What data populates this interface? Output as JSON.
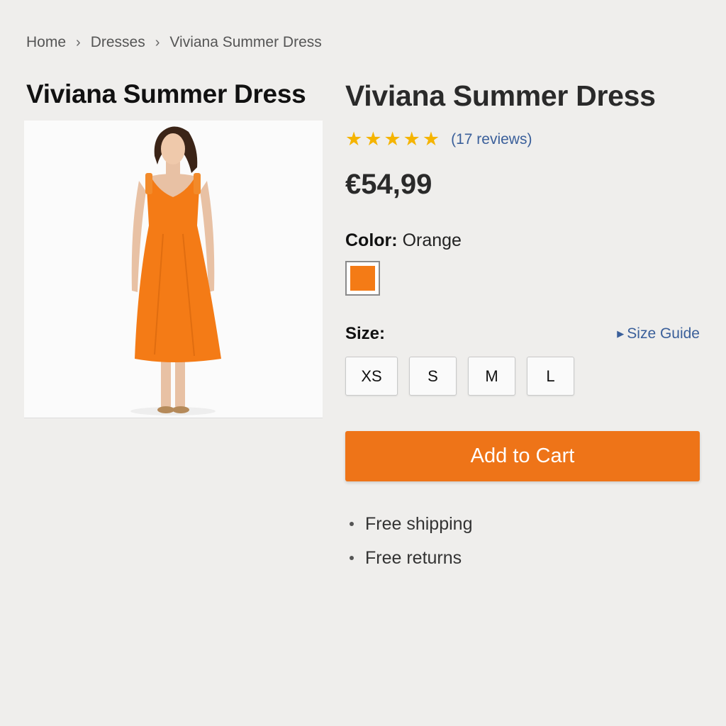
{
  "breadcrumb": {
    "items": [
      "Home",
      "Dresses",
      "Viviana Summer Dress"
    ],
    "separator": "›"
  },
  "product": {
    "title": "Viviana Summer Dress",
    "rating": 5,
    "reviews_label": "(17 reviews)",
    "price": "€54,99",
    "color_label": "Color:",
    "color_value": "Orange",
    "swatch_color": "#f47b16",
    "size_label": "Size:",
    "size_guide_label": "Size Guide",
    "sizes": [
      "XS",
      "S",
      "M",
      "L"
    ],
    "add_to_cart_label": "Add to Cart",
    "perks": [
      "Free shipping",
      "Free returns"
    ]
  },
  "colors": {
    "accent": "#ee7418",
    "star": "#f5b400",
    "link": "#3a5f9a"
  },
  "icons": {
    "star": "star-icon",
    "size_guide": "triangle-right-icon"
  }
}
